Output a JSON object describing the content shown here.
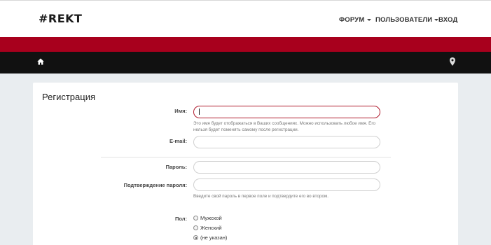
{
  "header": {
    "logo": "#REKT",
    "nav": [
      {
        "label": "ФОРУМ",
        "dropdown": true
      },
      {
        "label": "ПОЛЬЗОВАТЕЛИ",
        "dropdown": true
      },
      {
        "label": "ВХОД",
        "dropdown": false
      }
    ]
  },
  "colors": {
    "accent_red": "#a8001d",
    "bar_black": "#111111",
    "background": "#e9edf0"
  },
  "breadcrumb": {
    "home_icon": "home-icon",
    "location_icon": "map-pin-icon"
  },
  "form": {
    "title": "Регистрация",
    "name": {
      "label": "Имя:",
      "value": "",
      "hint": "Это имя будет отображаться в Ваших сообщениях. Можно использовать любое имя. Его нельзя будет поменять самому после регистрации."
    },
    "email": {
      "label": "E-mail:",
      "value": ""
    },
    "password": {
      "label": "Пароль:",
      "value": ""
    },
    "password_confirm": {
      "label": "Подтверждение пароля:",
      "value": "",
      "hint": "Введите свой пароль в первое поле и подтвердите его во втором."
    },
    "gender": {
      "label": "Пол:",
      "options": [
        "Мужской",
        "Женский",
        "(не указан)"
      ],
      "selected": "(не указан)"
    }
  }
}
